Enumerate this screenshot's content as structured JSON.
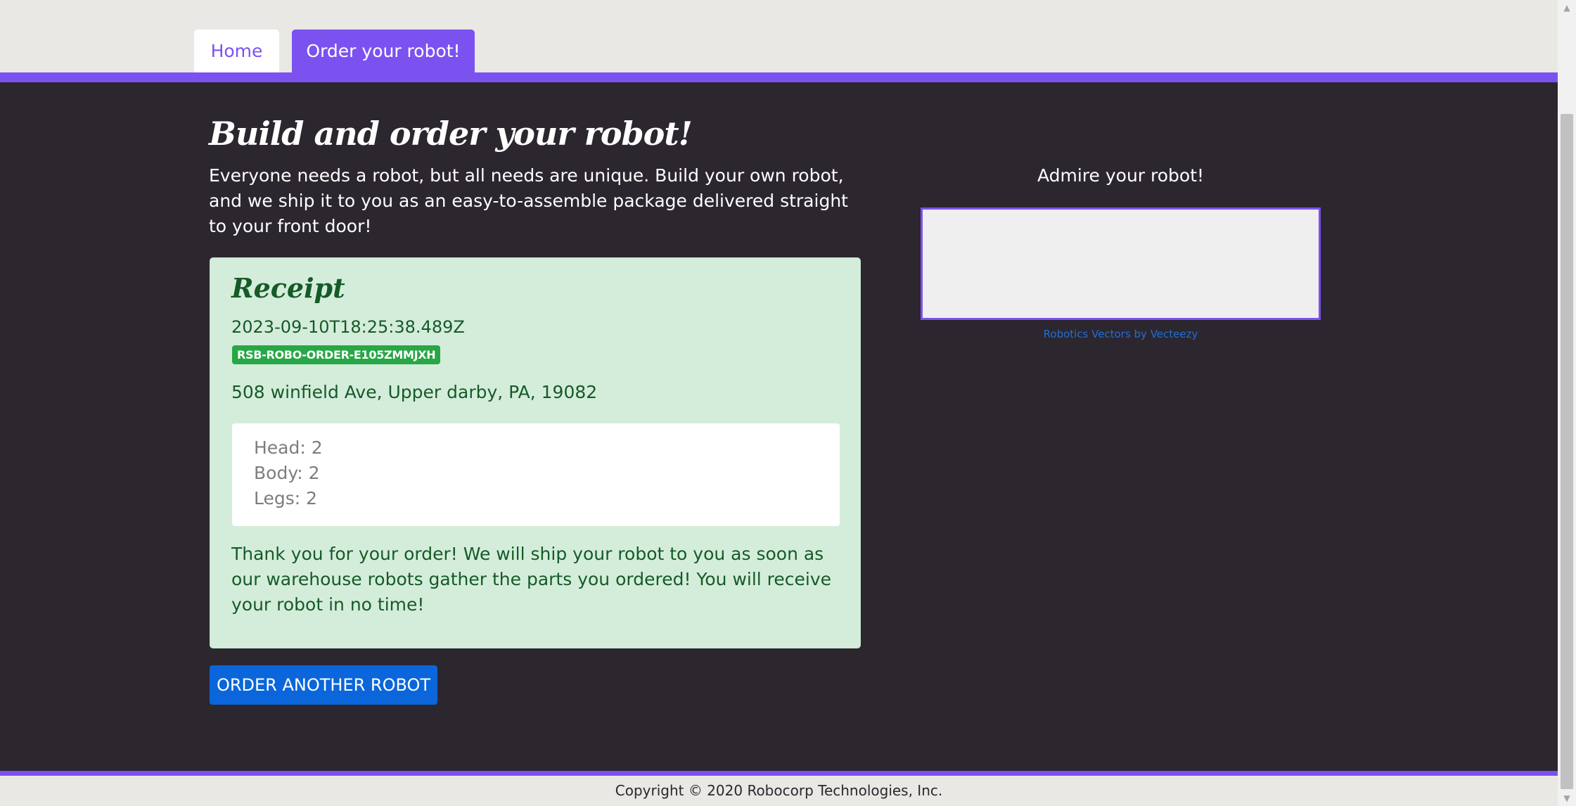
{
  "nav": {
    "tabs": [
      {
        "label": "Home",
        "active": false
      },
      {
        "label": "Order your robot!",
        "active": true
      }
    ]
  },
  "main": {
    "title": "Build and order your robot!",
    "intro": "Everyone needs a robot, but all needs are unique. Build your own robot, and we ship it to you as an easy-to-assemble package delivered straight to your front door!",
    "receipt": {
      "title": "Receipt",
      "timestamp": "2023-09-10T18:25:38.489Z",
      "order_id": "RSB-ROBO-ORDER-E105ZMMJXH",
      "address": "508 winfield Ave, Upper darby, PA, 19082",
      "parts": [
        {
          "label": "Head: 2"
        },
        {
          "label": "Body: 2"
        },
        {
          "label": "Legs: 2"
        }
      ],
      "thank_you": "Thank you for your order! We will ship your robot to you as soon as our warehouse robots gather the parts you ordered! You will receive your robot in no time!"
    },
    "order_another_label": "ORDER ANOTHER ROBOT",
    "preview": {
      "label": "Admire your robot!",
      "credit_link": "Robotics Vectors by Vecteezy"
    }
  },
  "footer": {
    "copyright": "Copyright © 2020 Robocorp Technologies, Inc."
  },
  "colors": {
    "accent": "#7b52f0",
    "background": "#2c262e",
    "receipt_bg": "#d4eddb",
    "receipt_text": "#165a27",
    "badge": "#27a745",
    "button": "#0a66da"
  }
}
